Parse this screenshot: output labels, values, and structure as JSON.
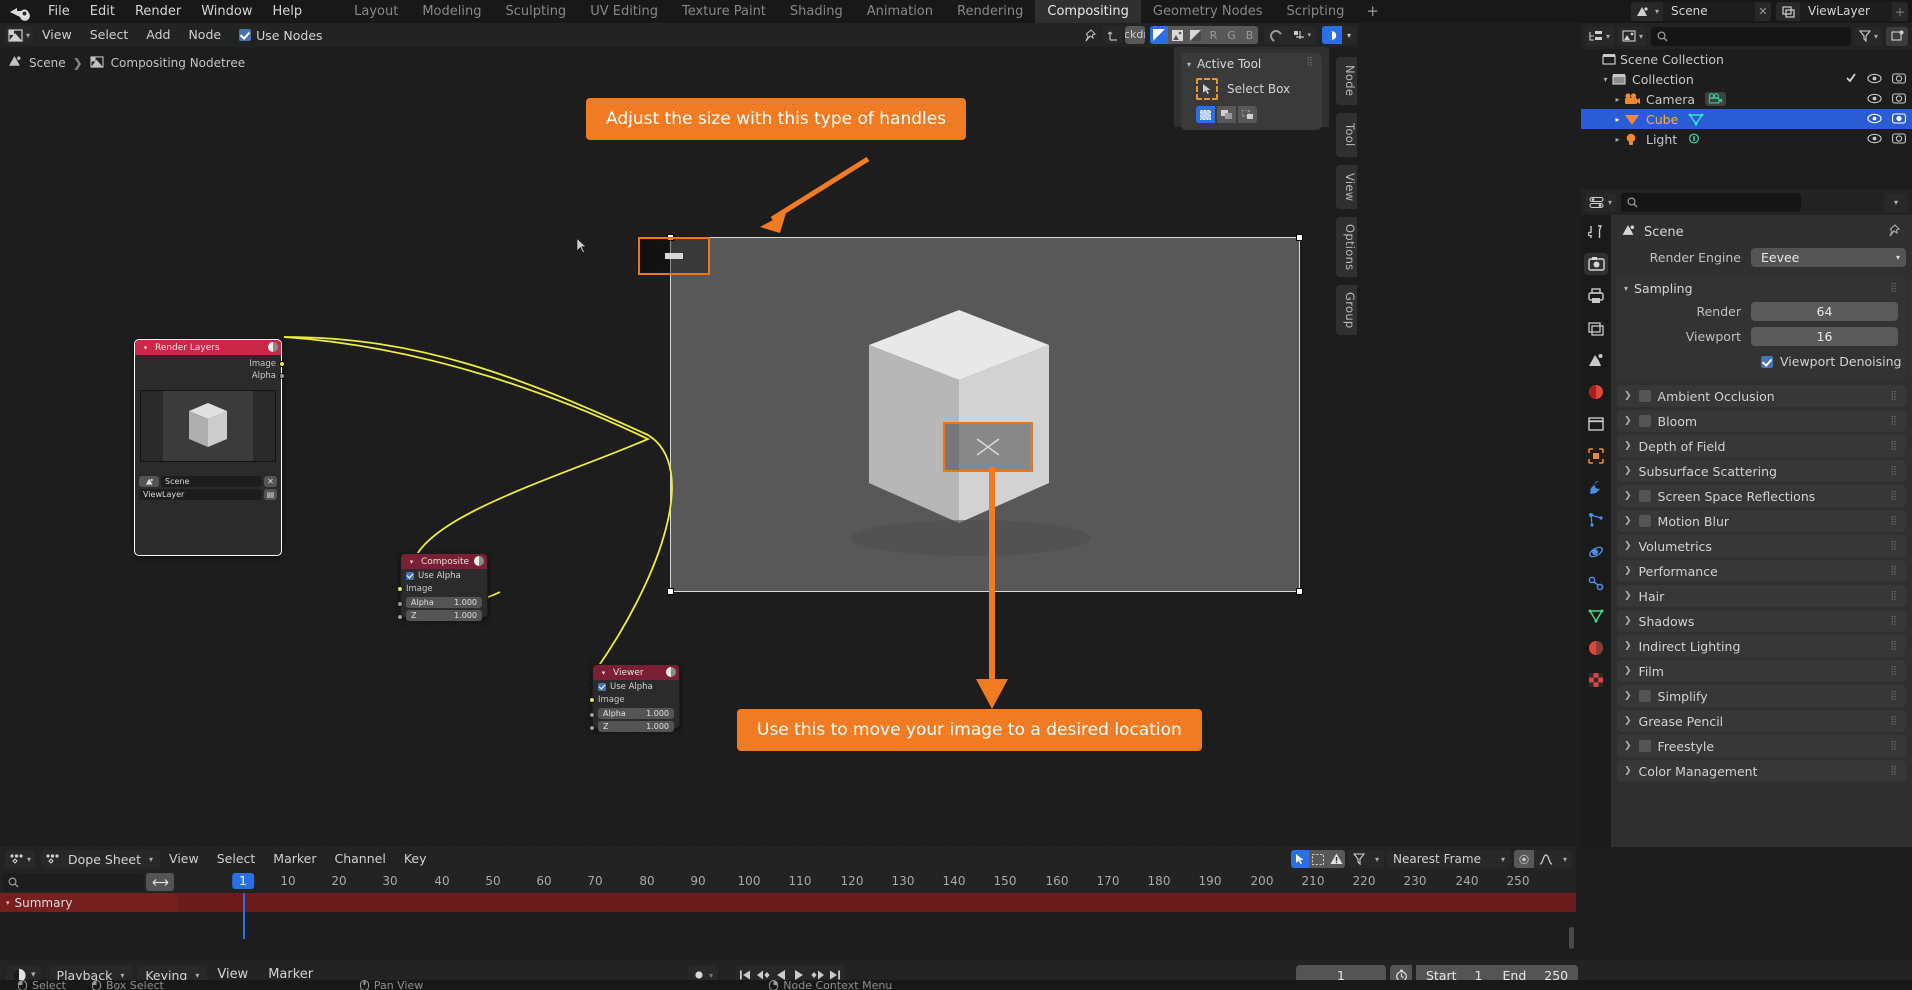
{
  "topbar": {
    "logo_icon": "blender-logo-icon",
    "menus": [
      "File",
      "Edit",
      "Render",
      "Window",
      "Help"
    ],
    "workspaces": [
      {
        "label": "Layout",
        "active": false
      },
      {
        "label": "Modeling",
        "active": false
      },
      {
        "label": "Sculpting",
        "active": false
      },
      {
        "label": "UV Editing",
        "active": false
      },
      {
        "label": "Texture Paint",
        "active": false
      },
      {
        "label": "Shading",
        "active": false
      },
      {
        "label": "Animation",
        "active": false
      },
      {
        "label": "Rendering",
        "active": false
      },
      {
        "label": "Compositing",
        "active": true
      },
      {
        "label": "Geometry Nodes",
        "active": false
      },
      {
        "label": "Scripting",
        "active": false
      }
    ],
    "add_workspace": "+",
    "scene_name": "Scene",
    "viewlayer_name": "ViewLayer",
    "scene_icon": "scene-icon",
    "viewlayer_icon": "view-layer-icon"
  },
  "node_editor": {
    "editor_type_icon": "compositor-editor-icon",
    "menus": [
      "View",
      "Select",
      "Add",
      "Node"
    ],
    "use_nodes_label": "Use Nodes",
    "use_nodes_checked": true,
    "breadcrumb_scene": "Scene",
    "breadcrumb_tree": "Compositing Nodetree",
    "header_right": {
      "pin_icon": "pin-icon",
      "up_icon": "arrow-up-icon",
      "backdrop_label": "Backdrop",
      "channel_buttons": [
        "color-alpha-icon",
        "image-icon",
        "alpha-icon",
        "R",
        "G",
        "B"
      ],
      "snap_icon": "snap-magnet-icon",
      "snap_to_icon": "snap-increment-icon",
      "overlays_icon": "overlays-icon"
    },
    "vertical_tabs": [
      "Node",
      "Tool",
      "View",
      "Options",
      "Group"
    ],
    "sidebar": {
      "panel_title": "Active Tool",
      "tool_name": "Select Box",
      "tool_icon": "select-box-icon",
      "mode_icons": [
        "select-set-icon",
        "select-extend-icon",
        "select-subtract-icon"
      ]
    },
    "nodes": [
      {
        "id": "render-layers",
        "title": "Render Layers",
        "outputs": [
          "Image",
          "Alpha"
        ],
        "scene_field": "Scene",
        "layer_field": "ViewLayer",
        "header_color": "#cc2649"
      },
      {
        "id": "composite",
        "title": "Composite",
        "use_alpha_label": "Use Alpha",
        "use_alpha_checked": true,
        "input_label": "Image",
        "fields": [
          {
            "name": "Alpha",
            "value": "1.000"
          },
          {
            "name": "Z",
            "value": "1.000"
          }
        ],
        "header_color": "#7a1f34"
      },
      {
        "id": "viewer",
        "title": "Viewer",
        "use_alpha_label": "Use Alpha",
        "use_alpha_checked": true,
        "input_label": "Image",
        "fields": [
          {
            "name": "Alpha",
            "value": "1.000"
          },
          {
            "name": "Z",
            "value": "1.000"
          }
        ],
        "header_color": "#7a1f34"
      }
    ],
    "link_color": "#eded3a"
  },
  "annotations": [
    {
      "id": "size-callout",
      "text": "Adjust the size with this type of handles",
      "color": "#f07b23"
    },
    {
      "id": "move-callout",
      "text": "Use this to move your image to a desired location",
      "color": "#f07b23"
    }
  ],
  "outliner": {
    "display_mode_icon": "outliner-mode-icon",
    "filter_type_icon": "outliner-display-icon",
    "search_placeholder": "",
    "search_icon": "search-icon",
    "filter_icon": "filter-funnel-icon",
    "new_collection_icon": "new-collection-icon",
    "rows": [
      {
        "label": "Scene Collection",
        "icon": "collection-icon",
        "depth": 0,
        "selected": false,
        "has_tri": false,
        "show_toggles": false
      },
      {
        "label": "Collection",
        "icon": "collection-icon",
        "depth": 1,
        "selected": false,
        "has_tri": true,
        "show_toggles": true,
        "checkbox": true
      },
      {
        "label": "Camera",
        "icon": "camera-object-icon",
        "data_icon": "camera-data-icon",
        "depth": 2,
        "selected": false,
        "has_tri": true,
        "show_toggles": true
      },
      {
        "label": "Cube",
        "icon": "mesh-object-icon",
        "data_icon": "mesh-data-icon",
        "depth": 2,
        "selected": true,
        "has_tri": true,
        "show_toggles": true
      },
      {
        "label": "Light",
        "icon": "light-object-icon",
        "data_icon": "light-data-icon",
        "depth": 2,
        "selected": false,
        "has_tri": true,
        "show_toggles": true
      }
    ]
  },
  "properties": {
    "editor_icon": "properties-editor-icon",
    "search_icon": "search-icon",
    "search_placeholder": "",
    "tabs": [
      {
        "name": "tool-tab",
        "icon": "tool-icon",
        "active": false,
        "color": "#c9c9c9"
      },
      {
        "name": "render-tab",
        "icon": "render-camera-icon",
        "active": true,
        "color": "#c9c9c9"
      },
      {
        "name": "output-tab",
        "icon": "printer-icon",
        "active": false,
        "color": "#c9c9c9"
      },
      {
        "name": "view-layer-tab",
        "icon": "images-icon",
        "active": false,
        "color": "#c9c9c9"
      },
      {
        "name": "scene-tab",
        "icon": "scene-cone-icon",
        "active": false,
        "color": "#c9c9c9"
      },
      {
        "name": "world-tab",
        "icon": "world-globe-icon",
        "active": false,
        "color": "#e0453a"
      },
      {
        "name": "collection-tab",
        "icon": "collection-box-icon",
        "active": false,
        "color": "#c9c9c9"
      },
      {
        "name": "object-tab",
        "icon": "object-square-icon",
        "active": false,
        "color": "#ef8833"
      },
      {
        "name": "modifiers-tab",
        "icon": "wrench-icon",
        "active": false,
        "color": "#4b8ee6"
      },
      {
        "name": "particles-tab",
        "icon": "particles-icon",
        "active": false,
        "color": "#4b8ee6"
      },
      {
        "name": "physics-tab",
        "icon": "physics-orbit-icon",
        "active": false,
        "color": "#4b8ee6"
      },
      {
        "name": "constraints-tab",
        "icon": "constraint-icon",
        "active": false,
        "color": "#4b8ee6"
      },
      {
        "name": "data-tab",
        "icon": "mesh-data-icon",
        "active": false,
        "color": "#3ddc84"
      },
      {
        "name": "material-tab",
        "icon": "material-sphere-icon",
        "active": false,
        "color": "#e0453a"
      },
      {
        "name": "texture-tab",
        "icon": "texture-checker-icon",
        "active": false,
        "color": "#e0453a"
      }
    ],
    "context_title": "Scene",
    "context_icon": "scene-icon",
    "pin_icon": "pin-icon",
    "render_engine_label": "Render Engine",
    "render_engine_value": "Eevee",
    "sampling": {
      "title": "Sampling",
      "rows": [
        {
          "label": "Render",
          "value": "64"
        },
        {
          "label": "Viewport",
          "value": "16"
        }
      ],
      "denoise_label": "Viewport Denoising",
      "denoise_checked": true
    },
    "panels": [
      {
        "label": "Ambient Occlusion",
        "checkbox": true,
        "checked": false
      },
      {
        "label": "Bloom",
        "checkbox": true,
        "checked": false
      },
      {
        "label": "Depth of Field",
        "checkbox": false
      },
      {
        "label": "Subsurface Scattering",
        "checkbox": false
      },
      {
        "label": "Screen Space Reflections",
        "checkbox": true,
        "checked": false
      },
      {
        "label": "Motion Blur",
        "checkbox": true,
        "checked": false
      },
      {
        "label": "Volumetrics",
        "checkbox": false
      },
      {
        "label": "Performance",
        "checkbox": false
      },
      {
        "label": "Hair",
        "checkbox": false
      },
      {
        "label": "Shadows",
        "checkbox": false
      },
      {
        "label": "Indirect Lighting",
        "checkbox": false
      },
      {
        "label": "Film",
        "checkbox": false
      },
      {
        "label": "Simplify",
        "checkbox": true,
        "checked": false
      },
      {
        "label": "Grease Pencil",
        "checkbox": false
      },
      {
        "label": "Freestyle",
        "checkbox": true,
        "checked": false
      },
      {
        "label": "Color Management",
        "checkbox": false
      }
    ]
  },
  "dope_sheet": {
    "editor_icon": "dope-sheet-editor-icon",
    "mode_icon": "dope-sheet-mode-icon",
    "mode_label": "Dope Sheet",
    "menus": [
      "View",
      "Select",
      "Marker",
      "Channel",
      "Key"
    ],
    "search_icon": "search-icon",
    "expand_icon": "expand-horizontal-icon",
    "right_tools": {
      "proportional_icon": "cursor-arrow-icon",
      "box_select_icon": "box-select-icon",
      "warning_icon": "warning-triangle-icon",
      "filter_icon": "filter-funnel-icon",
      "snap_label": "Nearest Frame",
      "proportional_edit_icon": "proportional-edit-icon",
      "falloff_icon": "falloff-curve-icon"
    },
    "summary_label": "Summary",
    "current_frame": 1,
    "ticks": [
      10,
      20,
      30,
      40,
      50,
      60,
      70,
      80,
      90,
      100,
      110,
      120,
      130,
      140,
      150,
      160,
      170,
      180,
      190,
      200,
      210,
      220,
      230,
      240,
      250
    ]
  },
  "timeline_footer": {
    "editor_icon": "timeline-editor-icon",
    "menus": [
      "Playback",
      "Keying",
      "View",
      "Marker"
    ],
    "keying_set_icon": "record-dot-icon",
    "transport": [
      "jump-start-icon",
      "prev-keyframe-icon",
      "play-reverse-icon",
      "play-icon",
      "next-keyframe-icon",
      "jump-end-icon"
    ],
    "frame_current": "1",
    "timer_icon": "auto-key-timer-icon",
    "start_label": "Start",
    "start_value": "1",
    "end_label": "End",
    "end_value": "250"
  },
  "status_bar": {
    "items": [
      {
        "icon": "mouse-left-icon",
        "label": "Select"
      },
      {
        "icon": "mouse-left-drag-icon",
        "label": "Box Select"
      },
      {
        "icon": "mouse-middle-icon",
        "label": "Pan View"
      },
      {
        "icon": "mouse-right-icon",
        "label": "Node Context Menu"
      }
    ]
  },
  "colors": {
    "accent_blue": "#2a6ee8",
    "annotation_orange": "#f07b23",
    "handle_orange": "#ee7711",
    "node_link_yellow": "#eded3a",
    "render_layers_header": "#cc2649",
    "outliner_select": "#2a5cd6",
    "summary_red": "#6b1d1d"
  }
}
